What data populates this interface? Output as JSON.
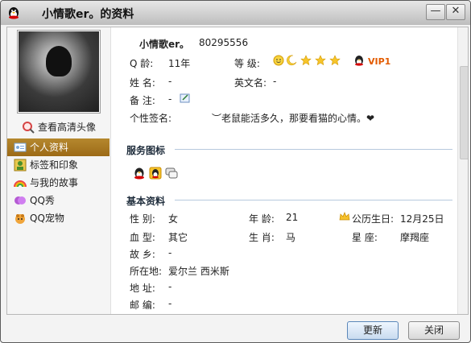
{
  "window": {
    "title": "小情歌er。的资料",
    "minimize": "—",
    "close": "✕"
  },
  "sidebar": {
    "hd_avatar": "查看高清头像",
    "items": [
      {
        "label": "个人资料"
      },
      {
        "label": "标签和印象"
      },
      {
        "label": "与我的故事"
      },
      {
        "label": "QQ秀"
      },
      {
        "label": "QQ宠物"
      }
    ]
  },
  "profile": {
    "nickname": "小情歌er。",
    "qq_number": "80295556",
    "qq_age_label": "Q 龄:",
    "qq_age": "11年",
    "level_label": "等 级:",
    "vip": "VIP1",
    "name_label": "姓 名:",
    "name": "-",
    "english_name_label": "英文名:",
    "english_name": "-",
    "remark_label": "备 注:",
    "remark": "-",
    "signature_label": "个性签名:",
    "signature": "︶老鼠能活多久，那要看猫的心情。❤"
  },
  "service_section": {
    "title": "服务图标"
  },
  "basic_section": {
    "title": "基本资料",
    "gender_label": "性 别:",
    "gender": "女",
    "age_label": "年 龄:",
    "age": "21",
    "lunar_birthday_label": "公历生日:",
    "lunar_birthday": "12月25日",
    "blood_label": "血 型:",
    "blood": "其它",
    "zodiac_label": "生 肖:",
    "zodiac": "马",
    "sign_label": "星 座:",
    "sign": "摩羯座",
    "hometown_label": "故 乡:",
    "hometown": "-",
    "location_label": "所在地:",
    "location": "爱尔兰 西米斯",
    "address_label": "地 址:",
    "address": "-",
    "postcode_label": "邮 编:",
    "postcode": "-"
  },
  "footer": {
    "refresh": "更新",
    "close": "关闭"
  }
}
